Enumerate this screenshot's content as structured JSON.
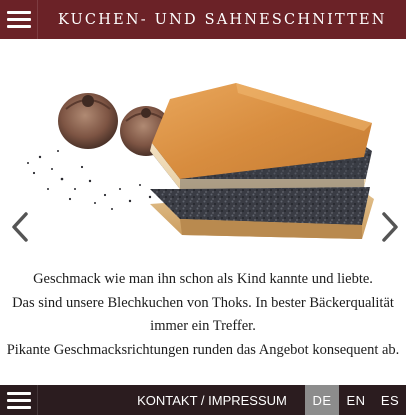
{
  "header": {
    "title": "KUCHEN- UND SAHNESCHNITTEN",
    "menu_icon": "hamburger-menu-icon",
    "color": "#6b2227"
  },
  "slider": {
    "image": "poppy-seed-cake-slice-with-poppy-pods",
    "prev_icon": "chevron-left-icon",
    "next_icon": "chevron-right-icon"
  },
  "intro": {
    "lines": [
      "Geschmack wie man ihn schon als Kind kannte und liebte.",
      "Das sind unsere Blechkuchen von Thoks. In bester Bäckerqualität",
      "immer ein Treffer.",
      "Pikante Geschmacksrichtungen runden das Angebot konsequent ab."
    ]
  },
  "footer": {
    "menu_icon": "hamburger-menu-icon",
    "link_label": "KONTAKT / IMPRESSUM",
    "languages": [
      "DE",
      "EN",
      "ES"
    ],
    "active_language": "DE",
    "color": "#2b1c1f"
  }
}
